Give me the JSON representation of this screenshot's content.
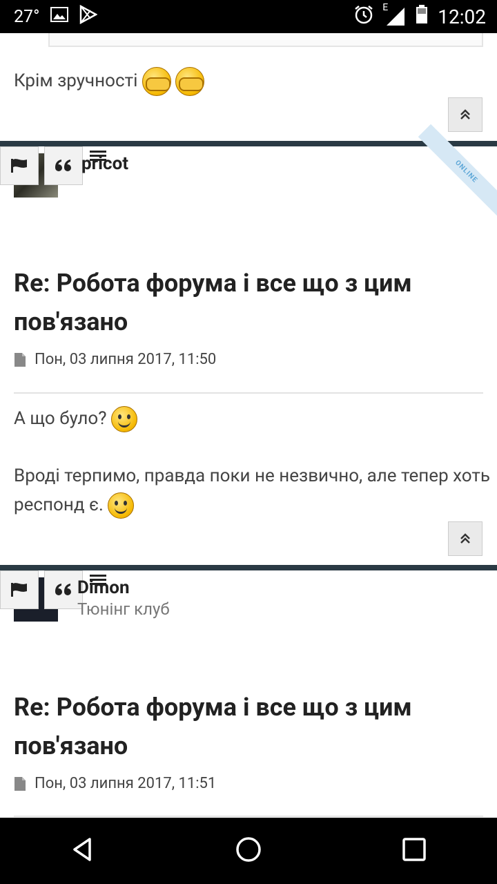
{
  "status_bar": {
    "temperature": "27°",
    "network_type": "E",
    "time": "12:02"
  },
  "posts": [
    {
      "body_lines": [
        "Крім зручності"
      ]
    },
    {
      "username": "pricot",
      "online_badge": "ONLINE",
      "title": "Re: Робота форума і все що з цим пов'язано",
      "date": "Пон, 03 липня 2017, 11:50",
      "body_p1": "А що було?",
      "body_p2": "Вроді терпимо, правда поки не незвично, але тепер хоть респонд є."
    },
    {
      "username": "Dimon",
      "user_rank": "Тюнінг клуб",
      "title": "Re: Робота форума і все що з цим пов'язано",
      "date": "Пон, 03 липня 2017, 11:51"
    }
  ],
  "icons": {
    "report": "flag-icon",
    "quote": "quote-icon",
    "menu": "hamburger-icon",
    "top": "double-chevron-up-icon",
    "date": "document-icon"
  },
  "colors": {
    "divider": "#2a3a44",
    "online_badge_bg": "#d6e8f5",
    "online_badge_text": "#5fa8d8"
  }
}
